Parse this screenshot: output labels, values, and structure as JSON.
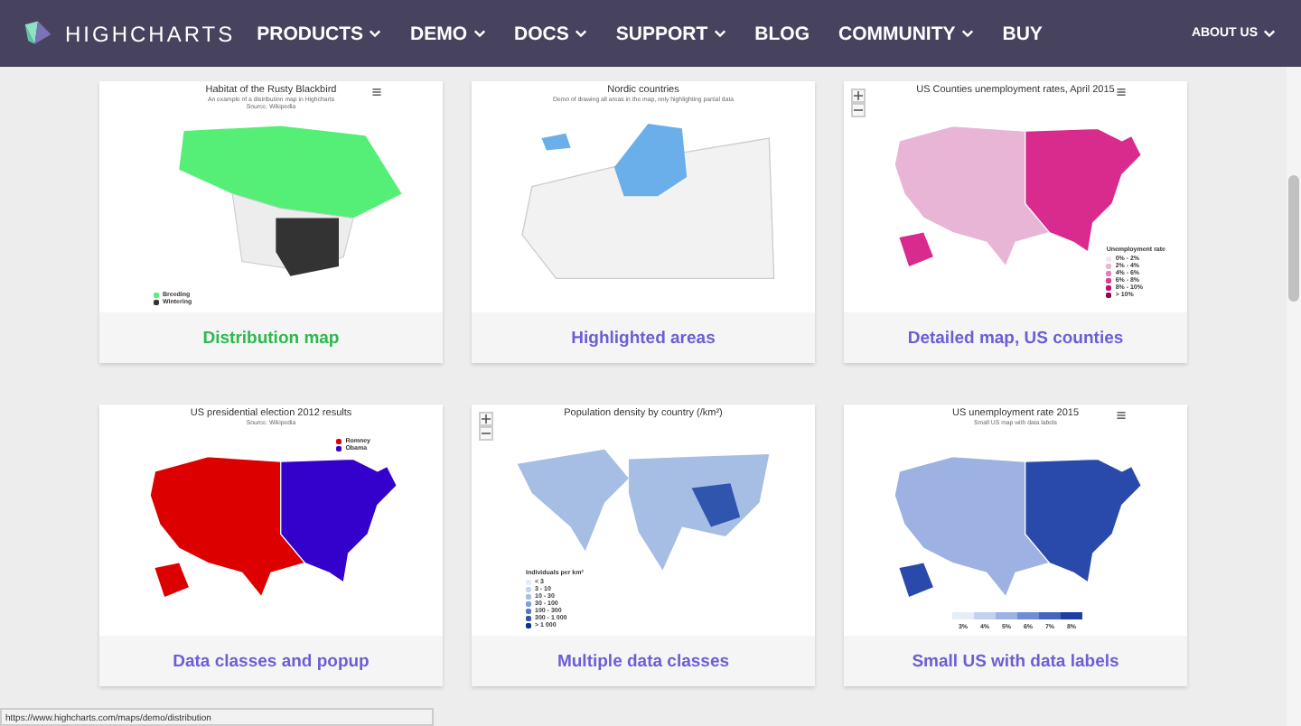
{
  "nav": {
    "brand": "HIGHCHARTS",
    "items": [
      {
        "label": "PRODUCTS",
        "dropdown": true
      },
      {
        "label": "DEMO",
        "dropdown": true
      },
      {
        "label": "DOCS",
        "dropdown": true
      },
      {
        "label": "SUPPORT",
        "dropdown": true
      },
      {
        "label": "BLOG",
        "dropdown": false
      },
      {
        "label": "COMMUNITY",
        "dropdown": true
      },
      {
        "label": "BUY",
        "dropdown": false
      }
    ],
    "right": {
      "label": "ABOUT US",
      "dropdown": true
    }
  },
  "cards": [
    {
      "kind": "distribution",
      "title": "Habitat of the Rusty Blackbird",
      "subtitle": "An example of a distribution map in Highcharts\nSource: Wikipedia",
      "menu": true,
      "zoom": false,
      "legend": [
        {
          "label": "Breeding",
          "color": "#55ee77"
        },
        {
          "label": "Wintering",
          "color": "#333333"
        }
      ],
      "label": "Distribution map",
      "hovered": true
    },
    {
      "kind": "nordic",
      "title": "Nordic countries",
      "subtitle": "Demo of drawing all areas in the map, only highlighting partial data",
      "menu": false,
      "zoom": false,
      "label": "Highlighted areas",
      "hovered": false
    },
    {
      "kind": "counties",
      "title": "US Counties unemployment rates, April 2015",
      "menu": true,
      "zoom": true,
      "legend_title": "Unemployment rate",
      "legend": [
        {
          "label": "0% - 2%",
          "color": "#f7e6f1"
        },
        {
          "label": "2% - 4%",
          "color": "#e8b5d6"
        },
        {
          "label": "4% - 6%",
          "color": "#e07fbd"
        },
        {
          "label": "6% - 8%",
          "color": "#e3379d"
        },
        {
          "label": "8% - 10%",
          "color": "#c0116e"
        },
        {
          "label": "> 10%",
          "color": "#8a0a4d"
        }
      ],
      "label": "Detailed map, US counties",
      "hovered": false
    },
    {
      "kind": "election",
      "title": "US presidential election 2012 results",
      "subtitle": "Source: Wikipedia",
      "menu": false,
      "zoom": false,
      "legend": [
        {
          "label": "Romney",
          "color": "#dd0000"
        },
        {
          "label": "Obama",
          "color": "#3300cc"
        }
      ],
      "label": "Data classes and popup",
      "hovered": false
    },
    {
      "kind": "density",
      "title": "Population density by country (/km²)",
      "menu": false,
      "zoom": true,
      "legend_title": "Individuals per km²",
      "legend": [
        {
          "label": "< 3",
          "color": "#e4ecf7"
        },
        {
          "label": "3 - 10",
          "color": "#c6d5ee"
        },
        {
          "label": "10 - 30",
          "color": "#a6bde4"
        },
        {
          "label": "30 - 100",
          "color": "#7f9fd6"
        },
        {
          "label": "100 - 300",
          "color": "#5479c4"
        },
        {
          "label": "300 - 1 000",
          "color": "#2f55ad"
        },
        {
          "label": "> 1 000",
          "color": "#132f8a"
        }
      ],
      "label": "Multiple data classes",
      "hovered": false
    },
    {
      "kind": "smallus",
      "title": "US unemployment rate 2015",
      "subtitle": "Small US map with data labels",
      "menu": true,
      "zoom": false,
      "legend": [
        {
          "label": "3%",
          "color": "#e6ecf8"
        },
        {
          "label": "4%",
          "color": "#c4d1ee"
        },
        {
          "label": "5%",
          "color": "#9db2e2"
        },
        {
          "label": "6%",
          "color": "#6f8dd2"
        },
        {
          "label": "7%",
          "color": "#4465bf"
        },
        {
          "label": "8%",
          "color": "#1f3ea5"
        }
      ],
      "label": "Small US with data labels",
      "hovered": false
    }
  ],
  "status_url": "https://www.highcharts.com/maps/demo/distribution"
}
